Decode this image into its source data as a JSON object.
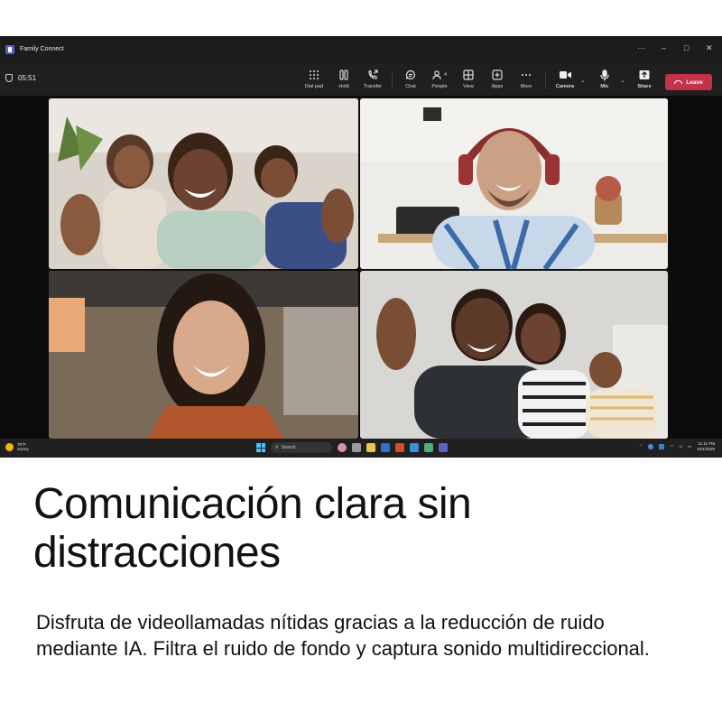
{
  "window": {
    "title": "Family Connect",
    "controls": {
      "more": "···",
      "minimize": "–",
      "maximize": "□",
      "close": "✕"
    }
  },
  "call": {
    "timer": "05:51",
    "toolbar": {
      "dial_pad": "Dial pad",
      "hold": "Hold",
      "transfer": "Transfer",
      "chat": "Chat",
      "people": "People",
      "people_count": "4",
      "view": "View",
      "apps": "Apps",
      "more": "More",
      "camera": "Camera",
      "mic": "Mic",
      "share": "Share",
      "leave": "Leave"
    },
    "colors": {
      "leave": "#c4314b",
      "toolbar_bg": "#1f1f1f",
      "screen_bg": "#0c0c0c"
    },
    "participants": [
      {
        "id": "family-of-three"
      },
      {
        "id": "man-with-headphones"
      },
      {
        "id": "smiling-woman"
      },
      {
        "id": "couple-with-baby"
      }
    ]
  },
  "taskbar": {
    "weather_temp": "78°F",
    "weather_cond": "Sunny",
    "search_placeholder": "Search",
    "time": "11:11 PM",
    "date": "10/1/2025"
  },
  "marketing": {
    "headline": "Comunicación clara sin distracciones",
    "body": "Disfruta de videollamadas nítidas gracias a la reducción de ruido mediante IA. Filtra el ruido de fondo y captura sonido multidireccional."
  }
}
